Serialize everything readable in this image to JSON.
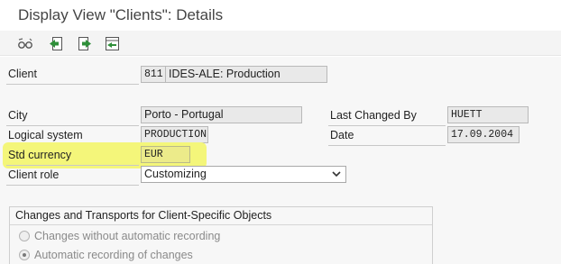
{
  "title": "Display View \"Clients\": Details",
  "toolbar": {
    "icons": [
      "glasses-icon",
      "previous-entry-icon",
      "next-entry-icon",
      "variable-list-icon"
    ]
  },
  "form": {
    "client_label": "Client",
    "client_number": "811",
    "client_name": "IDES-ALE: Production",
    "city_label": "City",
    "city_value": "Porto - Portugal",
    "last_changed_by_label": "Last Changed By",
    "last_changed_by_value": "HUETT",
    "logical_system_label": "Logical system",
    "logical_system_value": "PRODUCTION",
    "date_label": "Date",
    "date_value": "17.09.2004",
    "std_currency_label": "Std currency",
    "std_currency_value": "EUR",
    "client_role_label": "Client role",
    "client_role_value": "Customizing"
  },
  "changes_group": {
    "title": "Changes and Transports for Client-Specific Objects",
    "options": [
      {
        "label": "Changes without automatic recording",
        "selected": false
      },
      {
        "label": "Automatic recording of changes",
        "selected": true
      }
    ]
  },
  "colors": {
    "highlight": "#f4f67a",
    "field_bg": "#e9e9e9",
    "icon_green": "#2f8f3a"
  }
}
